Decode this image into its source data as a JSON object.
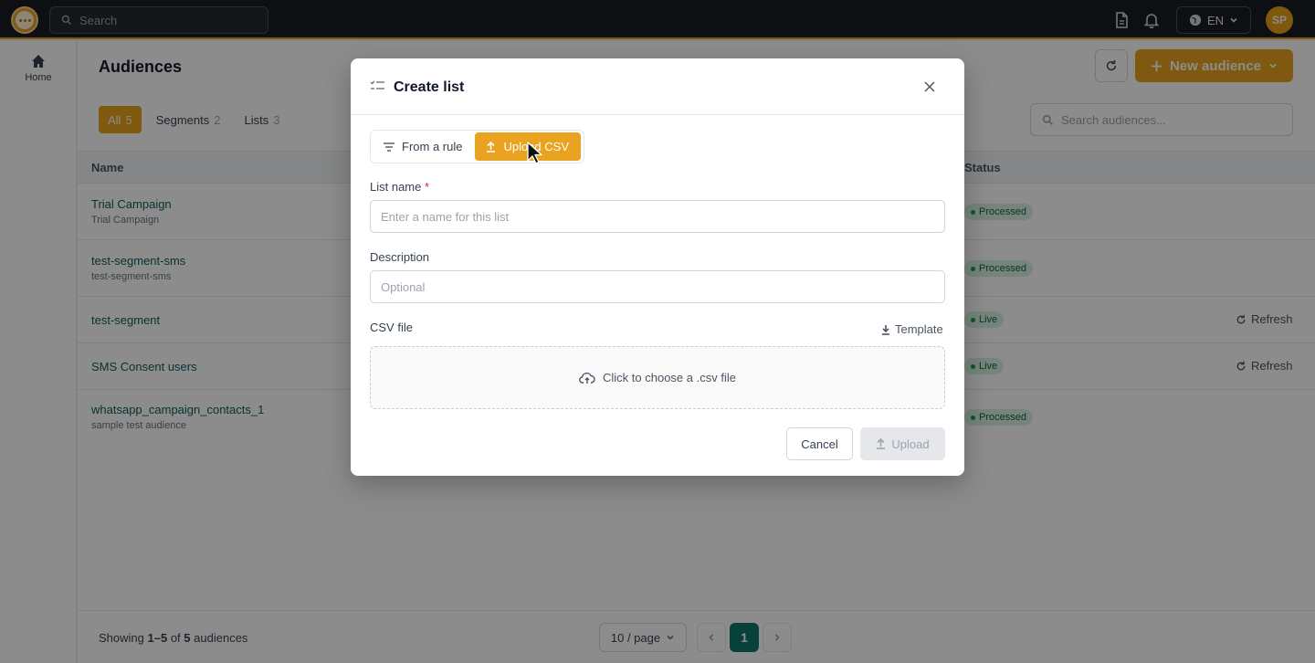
{
  "topbar": {
    "search_placeholder": "Search",
    "language": "EN",
    "avatar_initials": "SP"
  },
  "sidebar": {
    "home_label": "Home"
  },
  "page": {
    "title": "Audiences",
    "new_button": "New audience",
    "filters": [
      {
        "label": "All",
        "count": "5",
        "active": true
      },
      {
        "label": "Segments",
        "count": "2",
        "active": false
      },
      {
        "label": "Lists",
        "count": "3",
        "active": false
      }
    ],
    "search_placeholder": "Search audiences...",
    "columns": {
      "name": "Name",
      "status": "Status"
    },
    "rows": [
      {
        "title": "Trial Campaign",
        "subtitle": "Trial Campaign",
        "status": "Processed",
        "action": ""
      },
      {
        "title": "test-segment-sms",
        "subtitle": "test-segment-sms",
        "status": "Processed",
        "action": ""
      },
      {
        "title": "test-segment",
        "subtitle": "",
        "status": "Live",
        "action": "Refresh"
      },
      {
        "title": "SMS Consent users",
        "subtitle": "",
        "status": "Live",
        "action": "Refresh"
      },
      {
        "title": "whatsapp_campaign_contacts_1",
        "subtitle": "sample test audience",
        "status": "Processed",
        "action": ""
      }
    ],
    "footer": {
      "showing_prefix": "Showing",
      "range": "1–5",
      "of": "of",
      "total": "5",
      "suffix": "audiences",
      "per_page": "10 / page",
      "current_page": "1"
    }
  },
  "modal": {
    "title": "Create list",
    "tabs": [
      {
        "label": "From a rule",
        "active": false
      },
      {
        "label": "Upload CSV",
        "active": true
      }
    ],
    "list_name_label": "List name",
    "required_mark": "*",
    "list_name_placeholder": "Enter a name for this list",
    "description_label": "Description",
    "description_placeholder": "Optional",
    "csv_label": "CSV file",
    "template_link": "Template",
    "dropzone_text": "Click to choose a .csv file",
    "cancel_label": "Cancel",
    "upload_label": "Upload"
  },
  "colors": {
    "accent": "#e9a320",
    "topbar": "#1b1d21",
    "link": "#0f5c5a",
    "success_badge": "#d6f0e2",
    "page_active": "#0f766e"
  }
}
